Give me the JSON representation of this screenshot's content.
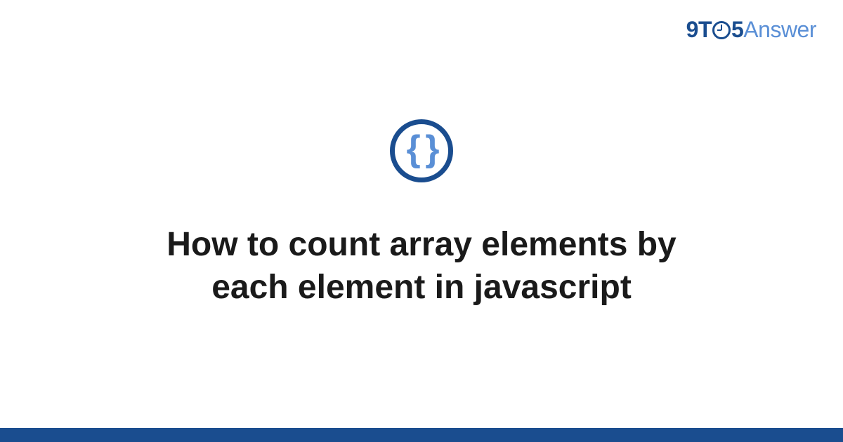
{
  "logo": {
    "part1": "9T",
    "part2": "5",
    "part3": "Answer"
  },
  "icon": {
    "name": "code-braces-icon",
    "glyph": "{ }"
  },
  "title": "How to count array elements by each element in javascript",
  "colors": {
    "primary": "#1a4d8f",
    "accent": "#5a8fd6",
    "text": "#1a1a1a"
  }
}
